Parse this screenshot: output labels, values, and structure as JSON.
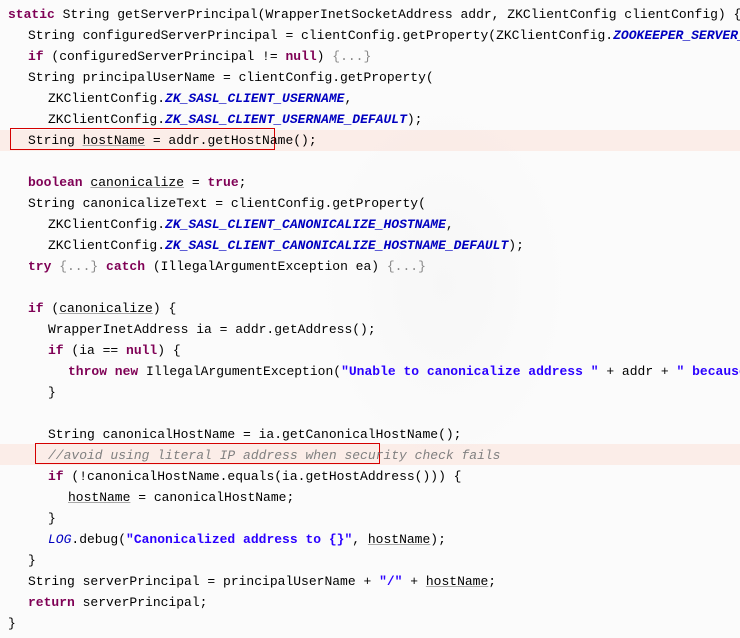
{
  "code": {
    "method_sig_1": "static",
    "method_sig_2": " String getServerPrincipal(WrapperInetSocketAddress addr, ZKClientConfig clientConfig) {",
    "l1a": "String configuredServerPrincipal = clientConfig.getProperty(ZKClientConfig.",
    "l1b": "ZOOKEEPER_SERVER_PRINCIPAL",
    "l1c": ");",
    "l2a": "if",
    "l2b": " (configuredServerPrincipal != ",
    "l2c": "null",
    "l2d": ") ",
    "l2fold": "{...}",
    "l3a": "String principalUserName = clientConfig.getProperty(",
    "l4a": "ZKClientConfig.",
    "l4b": "ZK_SASL_CLIENT_USERNAME",
    "l4c": ",",
    "l5a": "ZKClientConfig.",
    "l5b": "ZK_SASL_CLIENT_USERNAME_DEFAULT",
    "l5c": ");",
    "l6a": "String ",
    "l6b": "hostName",
    "l6c": " = addr.getHostName();",
    "l8a": "boolean",
    "l8b": " ",
    "l8c": "canonicalize",
    "l8d": " = ",
    "l8e": "true",
    "l8f": ";",
    "l9a": "String canonicalizeText = clientConfig.getProperty(",
    "l10a": "ZKClientConfig.",
    "l10b": "ZK_SASL_CLIENT_CANONICALIZE_HOSTNAME",
    "l10c": ",",
    "l11a": "ZKClientConfig.",
    "l11b": "ZK_SASL_CLIENT_CANONICALIZE_HOSTNAME_DEFAULT",
    "l11c": ");",
    "l12a": "try",
    "l12fold1": " {...} ",
    "l12b": "catch",
    "l12c": " (IllegalArgumentException ea) ",
    "l12fold2": "{...}",
    "l14a": "if",
    "l14b": " (",
    "l14c": "canonicalize",
    "l14d": ") {",
    "l15a": "WrapperInetAddress ia = addr.getAddress();",
    "l16a": "if",
    "l16b": " (ia == ",
    "l16c": "null",
    "l16d": ") {",
    "l17a": "throw new",
    "l17b": " IllegalArgumentException(",
    "l17c": "\"Unable to canonicalize address \"",
    "l17d": " + addr + ",
    "l17e": "\" because it's not resolvable\"",
    "l17f": ");",
    "l18a": "}",
    "l20a": "String canonicalHostName = ia.getCanonicalHostName();",
    "l21a": "//avoid using literal IP address when security check fails",
    "l22a": "if",
    "l22b": " (!canonicalHostName.equals(ia.getHostAddress())) {",
    "l23a": "hostName",
    "l23b": " = canonicalHostName;",
    "l24a": "}",
    "l25a": "LOG",
    "l25b": ".debug(",
    "l25c": "\"Canonicalized address to {}\"",
    "l25d": ", ",
    "l25e": "hostName",
    "l25f": ");",
    "l26a": "}",
    "l27a": "String serverPrincipal = principalUserName + ",
    "l27b": "\"/\"",
    "l27c": " + ",
    "l27d": "hostName",
    "l27e": ";",
    "l28a": "return",
    "l28b": " serverPrincipal;",
    "l29a": "}"
  }
}
